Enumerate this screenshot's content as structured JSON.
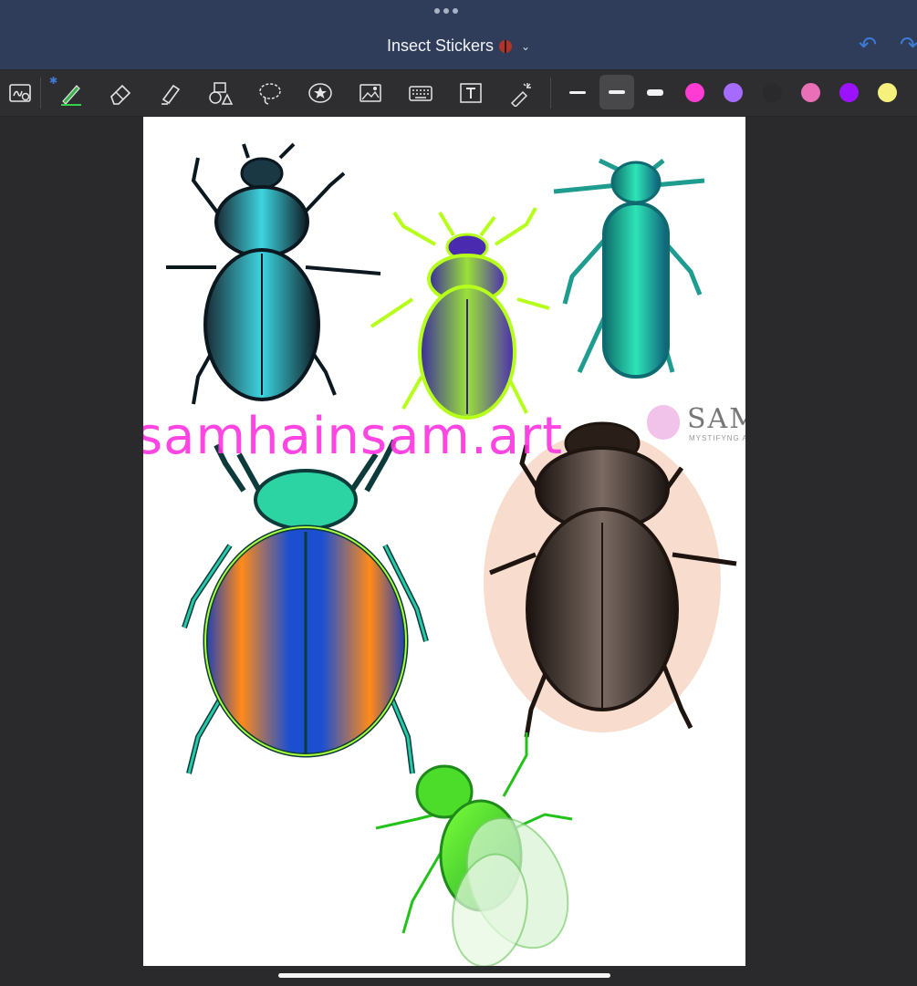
{
  "document": {
    "title": "Insect Stickers",
    "undo_icon": "undo-icon",
    "redo_icon": "redo-icon"
  },
  "toolbar": {
    "tools": [
      "zoom-window-icon",
      "pen-icon",
      "eraser-icon",
      "highlighter-icon",
      "shapes-icon",
      "lasso-icon",
      "sticker-icon",
      "image-icon",
      "keyboard-icon",
      "text-box-icon",
      "laser-pointer-icon"
    ],
    "selected_tool": "pen-icon",
    "bluetooth_icon": "bluetooth-icon",
    "stroke_sizes": [
      "thin",
      "medium",
      "thick"
    ],
    "selected_stroke": "medium",
    "colors": [
      "#ff3bd4",
      "#a56bff",
      "#2a2a2a",
      "#ea6fb6",
      "#9b12ff",
      "#f6f07c"
    ]
  },
  "canvas": {
    "watermark_text": "samhainsam.art",
    "logo": {
      "name": "SAM",
      "tagline": "MYSTIFYNG ARTIST"
    }
  }
}
